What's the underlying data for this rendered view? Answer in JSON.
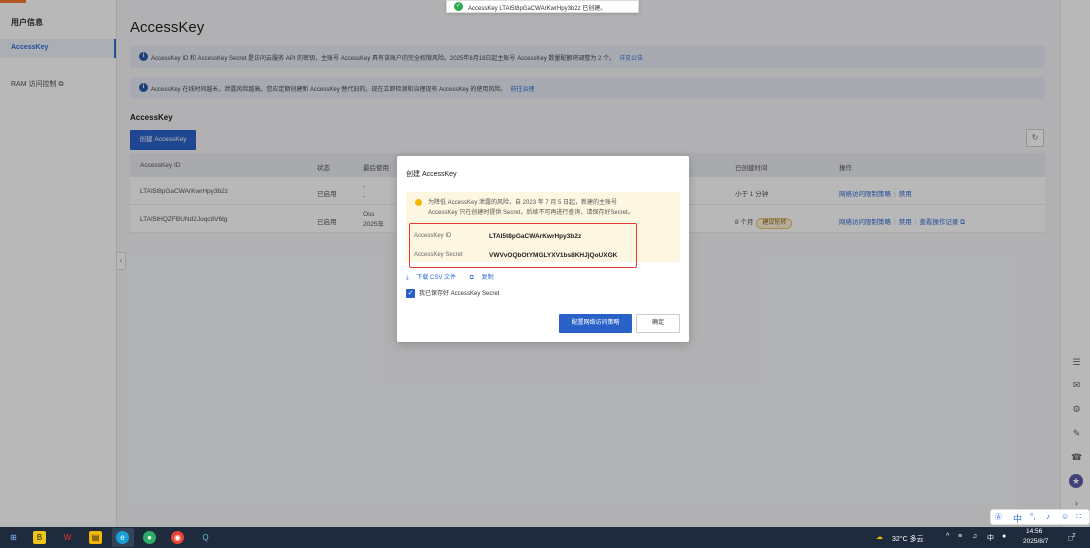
{
  "sidebar": {
    "section_title": "用户信息",
    "active_item": "AccessKey",
    "ram_item": "RAM 访问控制",
    "external_icon": "external-link-icon"
  },
  "page": {
    "title": "AccessKey",
    "notice1": {
      "text": "AccessKey ID 和 AccessKey Secret 是访问云服务 API 的密钥，主账号 AccessKey 具有该账户的完全权限风险。2025年8月18日起主账号 AccessKey 数量配额将调整为 2 个。",
      "link": "详见公告"
    },
    "notice2": {
      "text": "AccessKey 在线时间越长，泄露风险越高。您应定期创建新 AccessKey 替代旧的。现在立即检测和治理现有 AccessKey 的使用风险。",
      "link": "前往治理"
    },
    "subtitle": "AccessKey",
    "create_button": "创建 AccessKey",
    "refresh_icon": "refresh-icon"
  },
  "table": {
    "headers": {
      "id": "AccessKey ID",
      "status": "状态",
      "last_used": "最后使用",
      "created": "已创建时间",
      "ops": "操作"
    },
    "rows": [
      {
        "id": "LTAI5t8pGaCWArKwrHpy3b2z",
        "status": "已启用",
        "last_line1": "-",
        "last_line2": "-",
        "created": "小于 1 分钟",
        "badge": "",
        "op1": "网络访问限制策略",
        "op2": "禁用",
        "op3": ""
      },
      {
        "id": "LTAI5tHQZFBUNd2Joqc8V6tg",
        "status": "已启用",
        "last_line1": "Oss",
        "last_line2": "2025年",
        "created": "8 个月",
        "badge": "建议轮转",
        "op1": "网络访问限制策略",
        "op2": "禁用",
        "op3": "查看操作记录"
      }
    ]
  },
  "toast": {
    "text": "AccessKey LTAI5t8pGaCWArKwrHpy3b2z 已创建。"
  },
  "modal": {
    "title": "创建 AccessKey",
    "warning_line1": "为降低 AccessKey 泄露的风险，自 2023 年 7 月 5 日起，新建的主账号",
    "warning_line2": "AccessKey 只在创建时提供 Secret，后续不可再进行查询，请保存好Secret。",
    "id_label": "AccessKey ID",
    "id_value": "LTAI5t8pGaCWArKwrHpy3b2z",
    "secret_label": "AccessKey Secret",
    "secret_value": "VWVvOQbOtYMGLYXV1bs8KHJjQoUXGK",
    "download_link": "下载 CSV 文件",
    "copy_link": "复制",
    "checkbox_label": "我已保存好 AccessKey Secret",
    "primary_button": "配置网络访问策略",
    "ok_button": "确定"
  },
  "ime": {
    "lang": "中"
  },
  "taskbar": {
    "weather": "32°C 多云",
    "tray_lang": "中",
    "time": "14:56",
    "date": "2025/8/7",
    "notif_count": "2"
  },
  "colors": {
    "primary": "#2a61c9",
    "danger": "#e53935",
    "warning": "#f2b705",
    "success": "#2eaa4e"
  }
}
